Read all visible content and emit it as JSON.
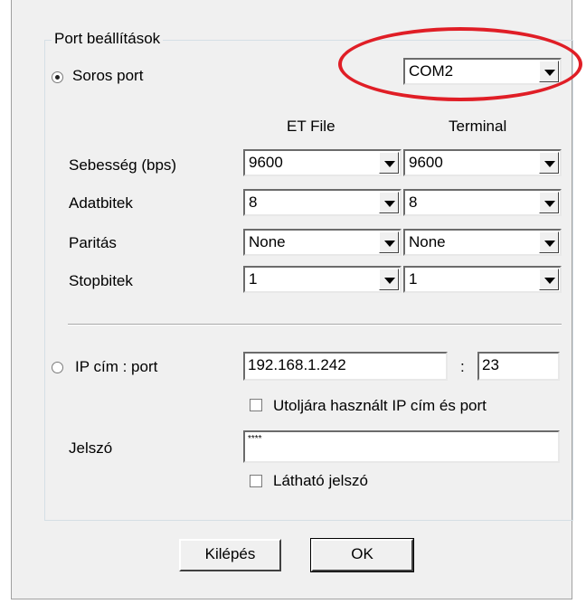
{
  "group": {
    "title": "Port beállítások"
  },
  "serial": {
    "radio_label": "Soros port",
    "port_value": "COM2",
    "col_etfile": "ET File",
    "col_terminal": "Terminal",
    "rows": [
      {
        "label": "Sebesség (bps)",
        "etfile": "9600",
        "terminal": "9600"
      },
      {
        "label": "Adatbitek",
        "etfile": "8",
        "terminal": "8"
      },
      {
        "label": "Paritás",
        "etfile": "None",
        "terminal": "None"
      },
      {
        "label": "Stopbitek",
        "etfile": "1",
        "terminal": "1"
      }
    ]
  },
  "ip": {
    "radio_label": "IP cím : port",
    "address": "192.168.1.242",
    "colon": ":",
    "port": "23",
    "remember_label": "Utoljára használt IP cím és port"
  },
  "password": {
    "label": "Jelszó",
    "value": "****",
    "show_label": "Látható jelszó"
  },
  "buttons": {
    "exit": "Kilépés",
    "ok": "OK"
  },
  "annotation_color": "#e01e26"
}
